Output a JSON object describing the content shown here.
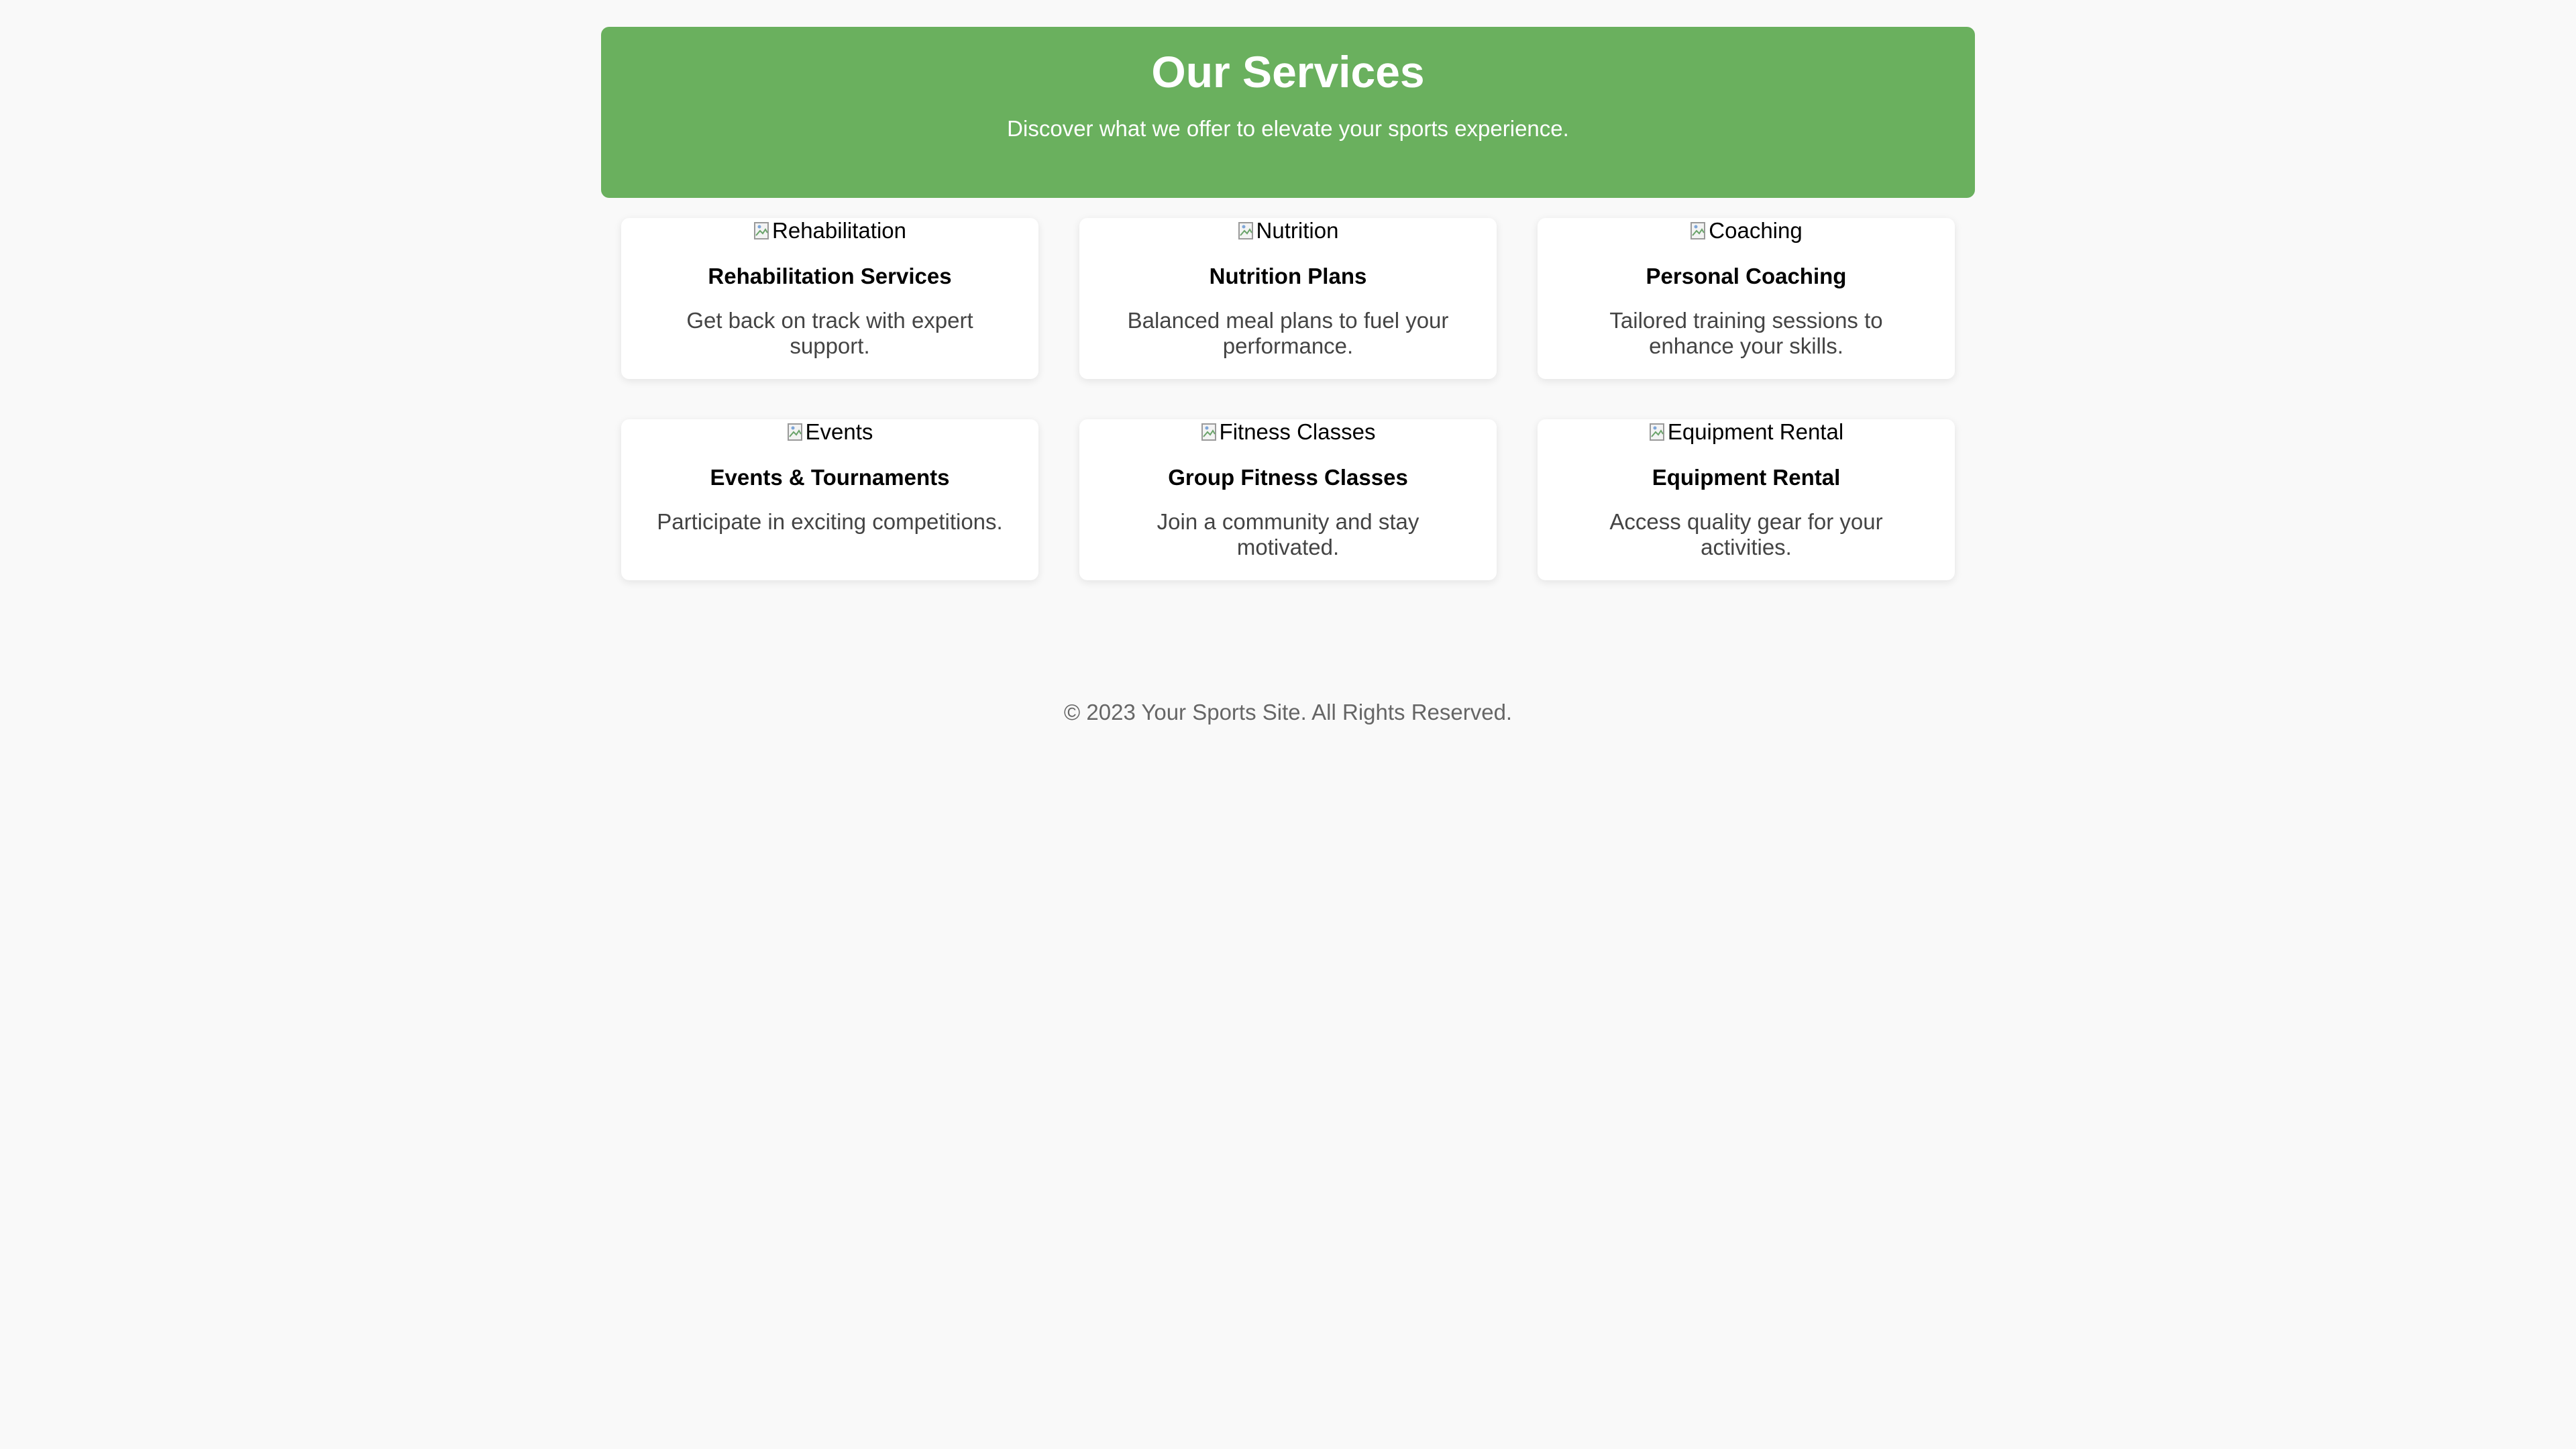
{
  "header": {
    "title": "Our Services",
    "subtitle": "Discover what we offer to elevate your sports experience."
  },
  "services": [
    {
      "image_alt": "Rehabilitation",
      "title": "Rehabilitation Services",
      "description": "Get back on track with expert support."
    },
    {
      "image_alt": "Nutrition",
      "title": "Nutrition Plans",
      "description": "Balanced meal plans to fuel your performance."
    },
    {
      "image_alt": "Coaching",
      "title": "Personal Coaching",
      "description": "Tailored training sessions to enhance your skills."
    },
    {
      "image_alt": "Events",
      "title": "Events & Tournaments",
      "description": "Participate in exciting competitions."
    },
    {
      "image_alt": "Fitness Classes",
      "title": "Group Fitness Classes",
      "description": "Join a community and stay motivated."
    },
    {
      "image_alt": "Equipment Rental",
      "title": "Equipment Rental",
      "description": "Access quality gear for your activities."
    }
  ],
  "footer": {
    "text": "© 2023 Your Sports Site. All Rights Reserved."
  },
  "colors": {
    "banner": "#6ab05e",
    "background": "#f9f9f9",
    "card": "#ffffff"
  },
  "icons": {
    "broken_image": "broken-image-icon"
  }
}
